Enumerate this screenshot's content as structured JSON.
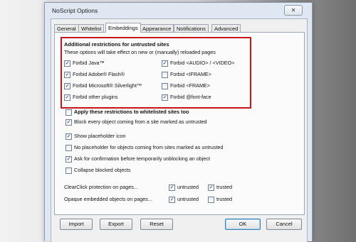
{
  "window": {
    "title": "NoScript Options",
    "close_glyph": "✕"
  },
  "tabs": [
    "General",
    "Whitelist",
    "Embeddings",
    "Appearance",
    "Notifications",
    "Advanced"
  ],
  "active_tab": "Embeddings",
  "restrictions": {
    "heading": "Additional restrictions for untrusted sites",
    "note": "These options will take effect on new or (manually) reloaded pages",
    "left": [
      {
        "label": "Forbid Java™",
        "checked": true
      },
      {
        "label": "Forbid Adobe® Flash®",
        "checked": true
      },
      {
        "label": "Forbid Microsoft® Silverlight™",
        "checked": true
      },
      {
        "label": "Forbid other plugins",
        "checked": true
      }
    ],
    "right": [
      {
        "label": "Forbid <AUDIO> / <VIDEO>",
        "checked": true
      },
      {
        "label": "Forbid <IFRAME>",
        "checked": false
      },
      {
        "label": "Forbid <FRAME>",
        "checked": false
      },
      {
        "label": "Forbid @font-face",
        "checked": true
      }
    ]
  },
  "options": [
    {
      "label": "Apply these restrictions to whitelisted sites too",
      "checked": false,
      "bold": true
    },
    {
      "label": "Block every object coming from a site marked as untrusted",
      "checked": true
    },
    {
      "label": "Show placeholder icon",
      "checked": true
    },
    {
      "label": "No placeholder for objects coming from sites marked as untrusted",
      "checked": false
    },
    {
      "label": "Ask for confirmation before temporarily unblocking an object",
      "checked": true
    },
    {
      "label": "Collapse blocked objects",
      "checked": false
    }
  ],
  "clearclick": {
    "label": "ClearClick protection on pages...",
    "untrusted": {
      "label": "untrusted",
      "checked": true
    },
    "trusted": {
      "label": "trusted",
      "checked": true
    }
  },
  "opaque": {
    "label": "Opaque embedded objects on pages...",
    "untrusted": {
      "label": "untrusted",
      "checked": true
    },
    "trusted": {
      "label": "trusted",
      "checked": false
    }
  },
  "buttons": {
    "import": "Import",
    "export": "Export",
    "reset": "Reset",
    "ok": "OK",
    "cancel": "Cancel"
  }
}
